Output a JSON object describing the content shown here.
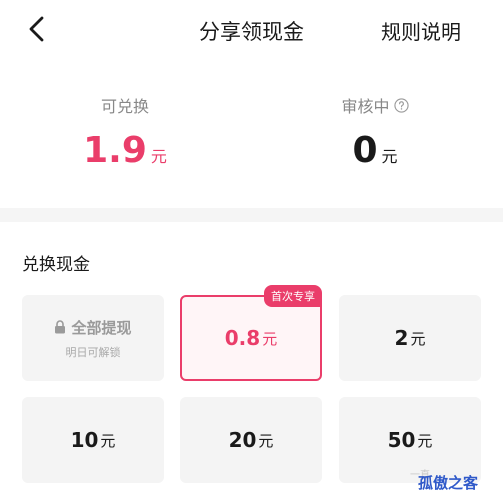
{
  "nav": {
    "title": "分享领现金",
    "rules": "规则说明"
  },
  "stats": {
    "available_label": "可兑换",
    "available_value": "1.9",
    "available_unit": "元",
    "review_label": "审核中",
    "review_value": "0",
    "review_unit": "元"
  },
  "section": {
    "title": "兑换现金"
  },
  "options": [
    {
      "label": "全部提现",
      "sub": "明日可解锁",
      "locked": true
    },
    {
      "value": "0.8",
      "unit": "元",
      "badge": "首次专享",
      "selected": true
    },
    {
      "value": "2",
      "unit": "元"
    },
    {
      "value": "10",
      "unit": "元"
    },
    {
      "value": "20",
      "unit": "元"
    },
    {
      "value": "50",
      "unit": "元"
    }
  ],
  "watermark": {
    "text": "孤傲之客",
    "faint": "一直"
  },
  "colors": {
    "accent": "#ea3d6a",
    "card_bg": "#f4f4f4",
    "divider": "#f5f5f5"
  }
}
